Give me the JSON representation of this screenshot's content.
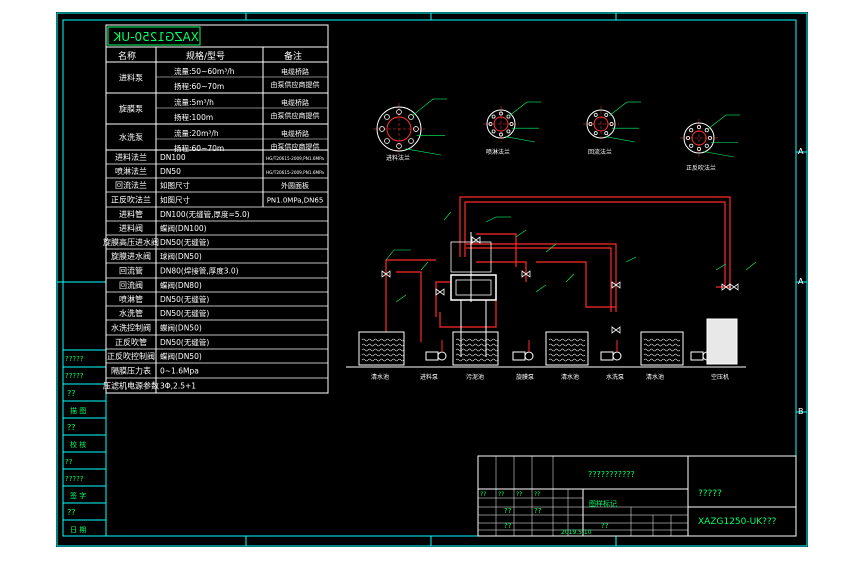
{
  "title_block": {
    "drawing_code": "XAZG1250-UK",
    "title_marks": "?????",
    "drawing_no": "XAZG1250-UK???",
    "project_marks": "???????????",
    "approval_label": "图样标记",
    "approval_label_short": "日期",
    "date": "2019.5.10",
    "small_marks": [
      "??",
      "??",
      "??",
      "??",
      "??",
      "??",
      "??",
      "??"
    ]
  },
  "left_stamp": {
    "rows": [
      "?????",
      "?????",
      "??",
      "??",
      "??",
      "??",
      "?????",
      "??",
      "??",
      "??",
      "??"
    ],
    "labels": [
      "借 用",
      "描 图",
      "校 核",
      "签 字",
      "日 期"
    ]
  },
  "spec_table": {
    "headers": [
      "名称",
      "规格/型号",
      "备注"
    ],
    "rows": [
      {
        "name": "进料泵",
        "spec": "流量:50~60m³/h",
        "spec2": "扬程:60~70m",
        "note": "电缆桥路",
        "note2": "由泵供应商提供"
      },
      {
        "name": "旋膜泵",
        "spec": "流量:5m³/h",
        "spec2": "扬程:100m",
        "note": "电缆桥路",
        "note2": "由泵供应商提供"
      },
      {
        "name": "水洗泵",
        "spec": "流量:20m³/h",
        "spec2": "扬程:60~70m",
        "note": "电缆桥路",
        "note2": "由泵供应商提供"
      },
      {
        "name": "进料法兰",
        "spec": "DN100",
        "spec2": "",
        "note": "HG/T20615-2009,PN1.6MPa",
        "note2": ""
      },
      {
        "name": "喷淋法兰",
        "spec": "DN50",
        "spec2": "",
        "note": "HG/T20615-2009,PN1.6MPa",
        "note2": ""
      },
      {
        "name": "回流法兰",
        "spec": "如图尺寸",
        "spec2": "",
        "note": "外圆面板",
        "note2": ""
      },
      {
        "name": "正反吹法兰",
        "spec": "如图尺寸",
        "spec2": "",
        "note": "PN1.0MPa,DN65",
        "note2": ""
      },
      {
        "name": "进料管",
        "spec": "DN100(无缝管,厚度=5.0)",
        "spec2": "",
        "note": "",
        "note2": ""
      },
      {
        "name": "进料阀",
        "spec": "蝶阀(DN100)",
        "spec2": "",
        "note": "",
        "note2": ""
      },
      {
        "name": "旋膜高压进水阀",
        "spec": "DN50(无缝管)",
        "spec2": "",
        "note": "",
        "note2": ""
      },
      {
        "name": "旋膜进水阀",
        "spec": "球阀(DN50)",
        "spec2": "",
        "note": "",
        "note2": ""
      },
      {
        "name": "回流管",
        "spec": "DN80(焊接管,厚度3.0)",
        "spec2": "",
        "note": "",
        "note2": ""
      },
      {
        "name": "回流阀",
        "spec": "蝶阀(DN80)",
        "spec2": "",
        "note": "",
        "note2": ""
      },
      {
        "name": "喷淋管",
        "spec": "DN50(无缝管)",
        "spec2": "",
        "note": "",
        "note2": ""
      },
      {
        "name": "水洗管",
        "spec": "DN50(无缝管)",
        "spec2": "",
        "note": "",
        "note2": ""
      },
      {
        "name": "水洗控制阀",
        "spec": "蝶阀(DN50)",
        "spec2": "",
        "note": "",
        "note2": ""
      },
      {
        "name": "正反吹管",
        "spec": "DN50(无缝管)",
        "spec2": "",
        "note": "",
        "note2": ""
      },
      {
        "name": "正反吹控制阀",
        "spec": "蝶阀(DN50)",
        "spec2": "",
        "note": "",
        "note2": ""
      },
      {
        "name": "隔膜压力表",
        "spec": "0~1.6Mpa",
        "spec2": "",
        "note": "",
        "note2": ""
      },
      {
        "name": "压滤机电源参数",
        "spec": "3Φ,2.5+1",
        "spec2": "",
        "note": "",
        "note2": ""
      }
    ]
  },
  "flanges": [
    {
      "label": "进料法兰"
    },
    {
      "label": "喷淋法兰"
    },
    {
      "label": "回流法兰"
    },
    {
      "label": "正反吹法兰"
    }
  ],
  "equipment": [
    {
      "label": "清水池"
    },
    {
      "label": "进料泵"
    },
    {
      "label": "污泥池"
    },
    {
      "label": "旋膜泵"
    },
    {
      "label": "清水池"
    },
    {
      "label": "水洗泵"
    },
    {
      "label": "清水池"
    },
    {
      "label": "空压机"
    }
  ],
  "border_letters": [
    "A",
    "A",
    "B",
    "A"
  ],
  "colors": {
    "line": "#00ff66",
    "frame": "#00ffff",
    "pipe": "#ff2a2a",
    "text": "#ffffff"
  }
}
